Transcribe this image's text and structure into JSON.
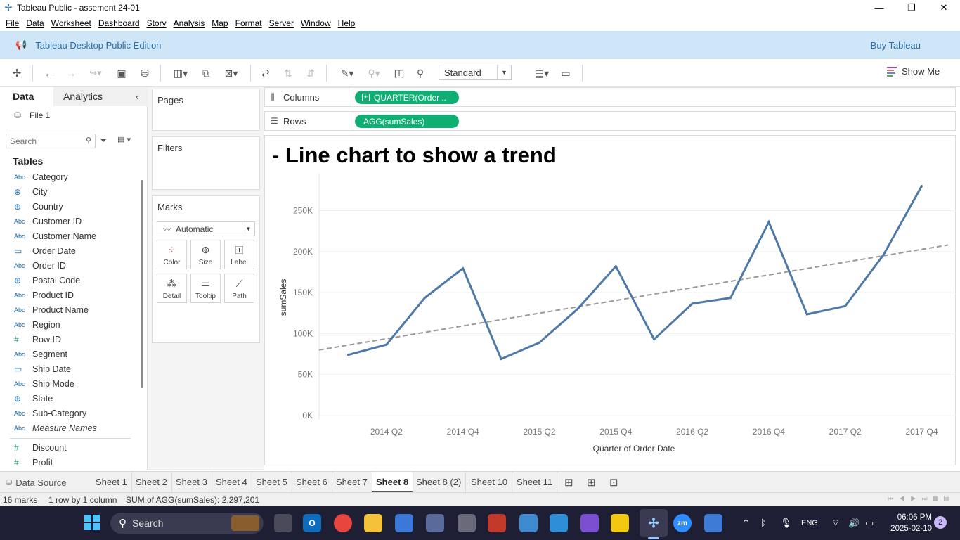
{
  "window": {
    "title": "Tableau Public - assement 24-01",
    "controls": {
      "minimize": "—",
      "restore": "❐",
      "close": "✕"
    }
  },
  "menu": [
    "File",
    "Data",
    "Worksheet",
    "Dashboard",
    "Story",
    "Analysis",
    "Map",
    "Format",
    "Server",
    "Window",
    "Help"
  ],
  "banner": {
    "edition": "Tableau Desktop Public Edition",
    "buy": "Buy Tableau"
  },
  "toolbar": {
    "fit_select": "Standard",
    "show_me": "Show Me"
  },
  "data_pane": {
    "tabs": {
      "data": "Data",
      "analytics": "Analytics"
    },
    "file": "File 1",
    "search_placeholder": "Search",
    "tables_heading": "Tables",
    "dimensions": [
      {
        "type": "Abc",
        "name": "Category"
      },
      {
        "type": "geo",
        "name": "City"
      },
      {
        "type": "geo",
        "name": "Country"
      },
      {
        "type": "Abc",
        "name": "Customer ID"
      },
      {
        "type": "Abc",
        "name": "Customer Name"
      },
      {
        "type": "date",
        "name": "Order Date"
      },
      {
        "type": "Abc",
        "name": "Order ID"
      },
      {
        "type": "geo",
        "name": "Postal Code"
      },
      {
        "type": "Abc",
        "name": "Product ID"
      },
      {
        "type": "Abc",
        "name": "Product Name"
      },
      {
        "type": "Abc",
        "name": "Region"
      },
      {
        "type": "num",
        "name": "Row ID"
      },
      {
        "type": "Abc",
        "name": "Segment"
      },
      {
        "type": "date",
        "name": "Ship Date"
      },
      {
        "type": "Abc",
        "name": "Ship Mode"
      },
      {
        "type": "geo",
        "name": "State"
      },
      {
        "type": "Abc",
        "name": "Sub-Category"
      },
      {
        "type": "Abc",
        "name": "Measure Names",
        "italic": true
      }
    ],
    "measures": [
      {
        "type": "num",
        "name": "Discount"
      },
      {
        "type": "num",
        "name": "Profit"
      }
    ]
  },
  "cards": {
    "pages": "Pages",
    "filters": "Filters",
    "marks": "Marks",
    "mark_type": "Automatic",
    "mark_buttons": [
      "Color",
      "Size",
      "Label",
      "Detail",
      "Tooltip",
      "Path"
    ]
  },
  "shelves": {
    "columns_label": "Columns",
    "columns_pill": "QUARTER(Order ..",
    "rows_label": "Rows",
    "rows_pill": "AGG(sumSales)"
  },
  "viz": {
    "title": "- Line chart to show a trend"
  },
  "chart_data": {
    "type": "line",
    "title": "- Line chart to show a trend",
    "xlabel": "Quarter of Order Date",
    "ylabel": "sumSales",
    "x": [
      "2014 Q1",
      "2014 Q2",
      "2014 Q3",
      "2014 Q4",
      "2015 Q1",
      "2015 Q2",
      "2015 Q3",
      "2015 Q4",
      "2016 Q1",
      "2016 Q2",
      "2016 Q3",
      "2016 Q4",
      "2017 Q1",
      "2017 Q2",
      "2017 Q3",
      "2017 Q4"
    ],
    "x_tick_labels": [
      "2014 Q2",
      "2014 Q4",
      "2015 Q2",
      "2015 Q4",
      "2016 Q2",
      "2016 Q4",
      "2017 Q2",
      "2017 Q4"
    ],
    "series": [
      {
        "values": [
          74000,
          86500,
          143500,
          179500,
          69000,
          89000,
          130000,
          182000,
          93000,
          136500,
          143500,
          236000,
          123500,
          133500,
          196000,
          280000
        ]
      }
    ],
    "trend_line": {
      "style": "dashed",
      "start": 80000,
      "end": 208000
    },
    "y_ticks": [
      0,
      50000,
      100000,
      150000,
      200000,
      250000
    ],
    "y_tick_labels": [
      "0K",
      "50K",
      "100K",
      "150K",
      "200K",
      "250K"
    ],
    "ylim": [
      0,
      295000
    ],
    "line_color": "#4e79a7",
    "trend_color": "#999999",
    "grid": true
  },
  "sheet_tabs": {
    "data_source": "Data Source",
    "sheets": [
      "Sheet 1",
      "Sheet 2",
      "Sheet 3",
      "Sheet 4",
      "Sheet 5",
      "Sheet 6",
      "Sheet 7",
      "Sheet 8",
      "Sheet 8 (2)",
      "Sheet 10",
      "Sheet 11"
    ],
    "active": "Sheet 8"
  },
  "status": {
    "marks": "16 marks",
    "dims": "1 row by 1 column",
    "sum": "SUM of AGG(sumSales): 2,297,201"
  },
  "taskbar": {
    "search": "Search",
    "lang": "ENG",
    "time": "06:06 PM",
    "date": "2025-02-10",
    "notifications": "2"
  }
}
